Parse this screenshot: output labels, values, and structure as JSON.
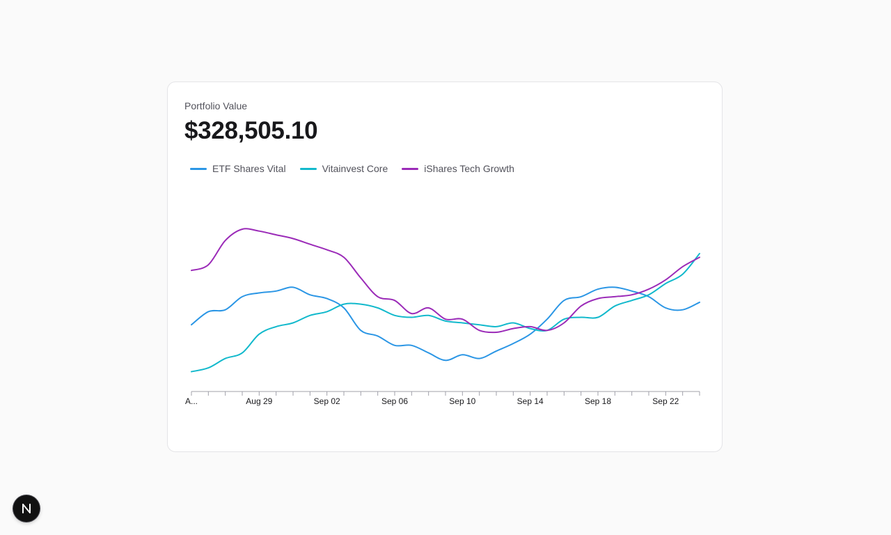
{
  "card": {
    "label": "Portfolio Value",
    "value": "$328,505.10"
  },
  "legend": [
    {
      "name": "ETF Shares Vital",
      "color": "#2b96e5"
    },
    {
      "name": "Vitainvest Core",
      "color": "#12b9cc"
    },
    {
      "name": "iShares Tech Growth",
      "color": "#9b2bb8"
    }
  ],
  "badge": {
    "icon": "nextjs-logo-icon"
  },
  "chart_data": {
    "type": "line",
    "title": "",
    "xlabel": "",
    "ylabel": "",
    "grid": false,
    "y_axis_visible": false,
    "legend_position": "top-left",
    "x_tick_labels": [
      "A...",
      "Aug 29",
      "Sep 02",
      "Sep 06",
      "Sep 10",
      "Sep 14",
      "Sep 18",
      "Sep 22"
    ],
    "x": [
      "Aug 25",
      "Aug 26",
      "Aug 27",
      "Aug 28",
      "Aug 29",
      "Aug 30",
      "Aug 31",
      "Sep 01",
      "Sep 02",
      "Sep 03",
      "Sep 04",
      "Sep 05",
      "Sep 06",
      "Sep 07",
      "Sep 08",
      "Sep 09",
      "Sep 10",
      "Sep 11",
      "Sep 12",
      "Sep 13",
      "Sep 14",
      "Sep 15",
      "Sep 16",
      "Sep 17",
      "Sep 18",
      "Sep 19",
      "Sep 20",
      "Sep 21",
      "Sep 22",
      "Sep 23",
      "Sep 24"
    ],
    "ylim": [
      0,
      100
    ],
    "series": [
      {
        "name": "ETF Shares Vital",
        "color": "#2b96e5",
        "values": [
          33,
          40,
          41,
          48,
          50,
          51,
          53,
          49,
          47,
          42,
          30,
          27,
          22,
          22,
          18,
          14,
          17,
          15,
          19,
          23,
          28,
          36,
          46,
          48,
          52,
          53,
          51,
          48,
          42,
          41,
          45
        ]
      },
      {
        "name": "Vitainvest Core",
        "color": "#12b9cc",
        "values": [
          8,
          10,
          15,
          18,
          28,
          32,
          34,
          38,
          40,
          44,
          44,
          42,
          38,
          37,
          38,
          35,
          34,
          33,
          32,
          34,
          31,
          30,
          36,
          37,
          37,
          43,
          46,
          49,
          55,
          60,
          71
        ]
      },
      {
        "name": "iShares Tech Growth",
        "color": "#9b2bb8",
        "values": [
          62,
          65,
          78,
          84,
          83,
          81,
          79,
          76,
          73,
          69,
          58,
          48,
          46,
          39,
          42,
          36,
          36,
          30,
          29,
          31,
          32,
          30,
          34,
          43,
          47,
          48,
          49,
          52,
          57,
          64,
          69
        ]
      }
    ]
  }
}
